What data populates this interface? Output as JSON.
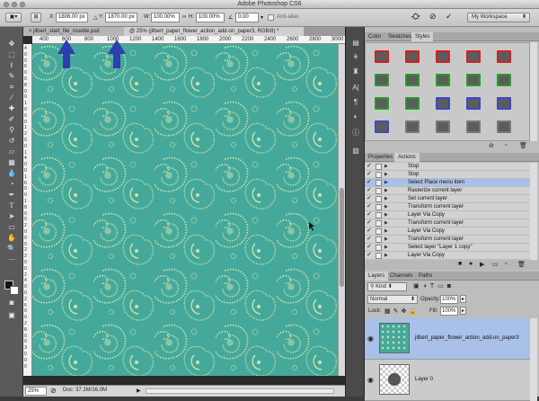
{
  "app": {
    "title": "Adobe Photoshop CS6"
  },
  "options_bar": {
    "x_label": "X:",
    "x_value": "1806.00 px",
    "y_label": "Y:",
    "y_value": "1870.00 px",
    "w_label": "W:",
    "w_value": "100.00%",
    "h_label": "H:",
    "h_value": "100.00%",
    "angle_value": "0.00",
    "antialias_label": "Anti-alias",
    "workspace_value": "My Workspace"
  },
  "tabs": [
    {
      "label": "jilbert_start_file_rosette.psd"
    },
    {
      "label": "@ 25% (jilbert_paper_flower_action_add-on_paper3, RGB/8) *"
    }
  ],
  "ruler_top": [
    "400",
    "600",
    "800",
    "1000",
    "1200",
    "1400",
    "1600",
    "1800",
    "2000",
    "2200",
    "2400",
    "2600",
    "2800",
    "3000"
  ],
  "ruler_left": [
    "4",
    "0",
    "0",
    "6",
    "0",
    "0",
    "8",
    "0",
    "0",
    "1",
    "0",
    "0",
    "0",
    "1",
    "2",
    "0",
    "0",
    "1",
    "4",
    "0",
    "0",
    "1",
    "6",
    "0",
    "0",
    "1",
    "8",
    "0",
    "0",
    "2",
    "0",
    "0",
    "0",
    "2",
    "2",
    "0",
    "0",
    "2",
    "4",
    "0",
    "0",
    "2",
    "6",
    "0",
    "0",
    "2",
    "8",
    "0",
    "0",
    "3",
    "0",
    "0",
    "0"
  ],
  "statusbar": {
    "zoom": "25%",
    "doc": "Doc: 37.1M/16.0M"
  },
  "styles_panel": {
    "tabs": [
      "Color",
      "Swatches",
      "Styles"
    ],
    "active": "Styles",
    "swatch_borders": [
      "#d42020",
      "#d42020",
      "#d42020",
      "#d42020",
      "#d42020",
      "#2a9a2a",
      "#2a9a2a",
      "#2a9a2a",
      "#2a9a2a",
      "#2a9a2a",
      "#2a9a2a",
      "#2a9a2a",
      "#3a4ac8",
      "#3a4ac8",
      "#3a4ac8",
      "#3a4ac8"
    ],
    "swatch_fill": "#5c5c5c"
  },
  "actions_panel": {
    "tabs": [
      "Properties",
      "Actions"
    ],
    "active": "Actions",
    "items": [
      {
        "label": "Stop",
        "checked": true,
        "selected": false
      },
      {
        "label": "Stop",
        "checked": true,
        "selected": false
      },
      {
        "label": "Select Place menu item",
        "checked": true,
        "selected": true
      },
      {
        "label": "Rasterize current layer",
        "checked": true,
        "selected": false
      },
      {
        "label": "Set current layer",
        "checked": true,
        "selected": false
      },
      {
        "label": "Transform current layer",
        "checked": true,
        "selected": false
      },
      {
        "label": "Layer Via Copy",
        "checked": true,
        "selected": false
      },
      {
        "label": "Transform current layer",
        "checked": true,
        "selected": false
      },
      {
        "label": "Layer Via Copy",
        "checked": true,
        "selected": false
      },
      {
        "label": "Transform current layer",
        "checked": true,
        "selected": false
      },
      {
        "label": "Select layer \"Layer 1 copy\"",
        "checked": true,
        "selected": false
      },
      {
        "label": "Layer Via Copy",
        "checked": true,
        "selected": false
      }
    ]
  },
  "layers_panel": {
    "tabs": [
      "Layers",
      "Channels",
      "Paths"
    ],
    "active": "Layers",
    "kind_label": "Kind",
    "blend_mode": "Normal",
    "opacity_label": "Opacity:",
    "opacity_value": "100%",
    "lock_label": "Lock:",
    "fill_label": "Fill:",
    "fill_value": "100%",
    "layers": [
      {
        "name": "jilbert_paper_flower_action_add-on_paper3",
        "selected": true
      },
      {
        "name": "Layer 0",
        "selected": false
      }
    ]
  },
  "colors": {
    "canvas": "#44a99a",
    "paisley": "#cfe3b0",
    "selection": "#a9c0e8",
    "arrow": "#2d3fb0"
  }
}
